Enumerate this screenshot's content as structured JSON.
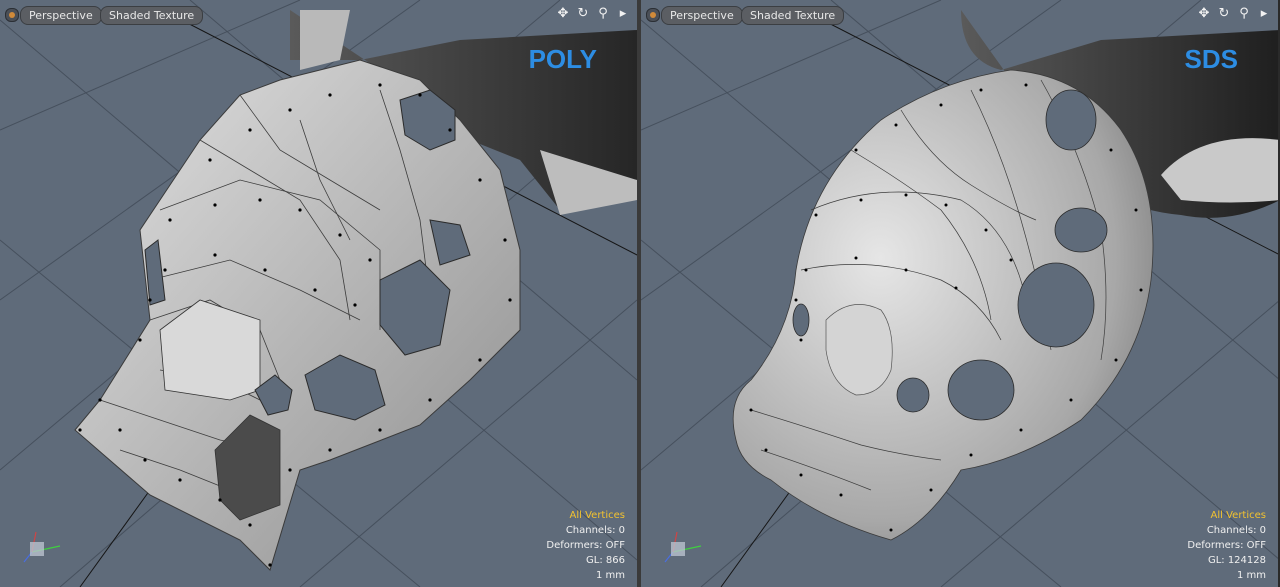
{
  "viewports": [
    {
      "view_menu": "Perspective",
      "shading_menu": "Shaded Texture",
      "tools": [
        {
          "icon": "move-view-icon",
          "glyph": "✥"
        },
        {
          "icon": "rotate-view-icon",
          "glyph": "↻"
        },
        {
          "icon": "zoom-view-icon",
          "glyph": "⚲"
        },
        {
          "icon": "expand-menu-icon",
          "glyph": "▸"
        }
      ],
      "label": "POLY",
      "info": {
        "selection": "All Vertices",
        "channels": "Channels: 0",
        "deformers": "Deformers: OFF",
        "gl": "GL: 866",
        "unit": "1 mm"
      }
    },
    {
      "view_menu": "Perspective",
      "shading_menu": "Shaded Texture",
      "tools": [
        {
          "icon": "move-view-icon",
          "glyph": "✥"
        },
        {
          "icon": "rotate-view-icon",
          "glyph": "↻"
        },
        {
          "icon": "zoom-view-icon",
          "glyph": "⚲"
        },
        {
          "icon": "expand-menu-icon",
          "glyph": "▸"
        }
      ],
      "label": "SDS",
      "info": {
        "selection": "All Vertices",
        "channels": "Channels: 0",
        "deformers": "Deformers: OFF",
        "gl": "GL: 124128",
        "unit": "1 mm"
      }
    }
  ],
  "colors": {
    "background": "#5f6b7a",
    "grid": "#3f4854",
    "mesh_light": "#c7c7c7",
    "mesh_dark": "#3a3a3a",
    "label": "#2d8de3",
    "selection": "#f2c230"
  }
}
